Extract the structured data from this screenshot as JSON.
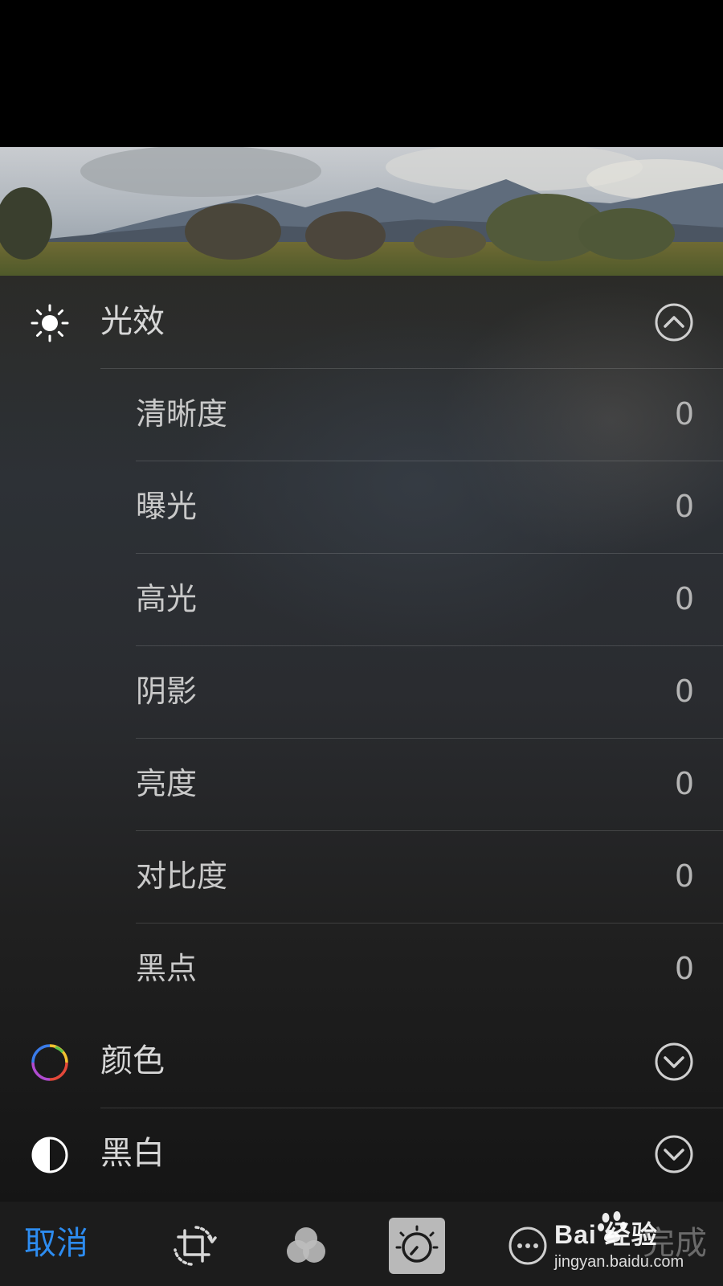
{
  "sections": {
    "light": {
      "label": "光效",
      "icon": "sun-icon",
      "expanded": true
    },
    "color": {
      "label": "颜色",
      "icon": "color-wheel-icon",
      "expanded": false
    },
    "bw": {
      "label": "黑白",
      "icon": "half-circle-icon",
      "expanded": false
    }
  },
  "adjustments": [
    {
      "label": "清晰度",
      "value": "0"
    },
    {
      "label": "曝光",
      "value": "0"
    },
    {
      "label": "高光",
      "value": "0"
    },
    {
      "label": "阴影",
      "value": "0"
    },
    {
      "label": "亮度",
      "value": "0"
    },
    {
      "label": "对比度",
      "value": "0"
    },
    {
      "label": "黑点",
      "value": "0"
    }
  ],
  "toolbar": {
    "cancel_label": "取消",
    "done_label": "完成",
    "tools": [
      "crop-rotate-icon",
      "filters-icon",
      "adjust-dial-icon",
      "more-options-icon"
    ],
    "active_tool": "adjust-dial-icon"
  },
  "watermark": {
    "brand": "Bai 经验",
    "url": "jingyan.baidu.com"
  },
  "colors": {
    "accent": "#2d8cf0",
    "background": "#000000",
    "toolbar": "#1c1c1c"
  }
}
